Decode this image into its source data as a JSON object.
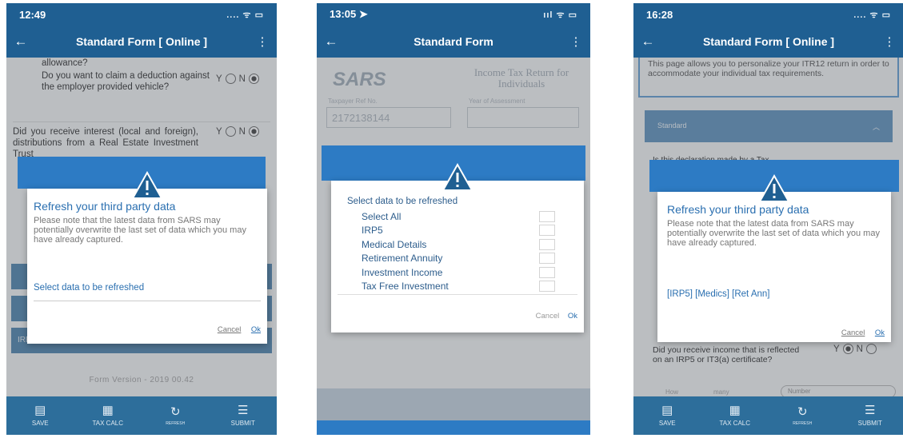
{
  "screens": [
    {
      "time": "12:49",
      "status_right": ".... ᯤ ▭",
      "title": "Standard Form [ Online ]",
      "questions": [
        {
          "text": "allowance?"
        },
        {
          "text": "Do you want to claim a deduction against the employer provided vehicle?",
          "yn": "Y ◯ N ◉"
        },
        {
          "text": "Did you receive interest (local and foreign), distributions from a Real Estate Investment Trust",
          "yn": "Y ◯ N ◉"
        }
      ],
      "bg_item": "IRP5/IT3(a)",
      "form_version": "Form Version - 2019 00.42",
      "dialog": {
        "title": "Refresh your third party data",
        "text": "Please note that the latest data from SARS may potentially overwrite the last set of data which you may have already captured.",
        "select_label": "Select data to be refreshed",
        "cancel": "Cancel",
        "ok": "Ok"
      },
      "nav": [
        {
          "label": "SAVE",
          "icon": "save-icon"
        },
        {
          "label": "TAX CALC",
          "icon": "calculator-icon"
        },
        {
          "label": "REFRESH",
          "icon": "refresh-icon"
        },
        {
          "label": "SUBMIT",
          "icon": "submit-icon"
        }
      ]
    },
    {
      "time": "13:05 ➤",
      "status_right": "ııl ᯤ ▭",
      "title": "Standard Form",
      "bg": {
        "logo": "SARS",
        "heading": "Income Tax Return for Individuals",
        "field1_label": "Taxpayer Ref No.",
        "field1_value": "2172138144",
        "field2_label": "Year of Assessment"
      },
      "dialog": {
        "select_label": "Select data to be refreshed",
        "items": [
          "Select All",
          "IRP5",
          "Medical Details",
          "Retirement Annuity",
          "Investment Income",
          "Tax Free Investment"
        ],
        "cancel": "Cancel",
        "ok": "Ok"
      }
    },
    {
      "time": "16:28",
      "status_right": ".... ᯤ ▭",
      "title": "Standard Form [ Online ]",
      "intro": "This page allows you to personalize your ITR12 return in order to accommodate your individual tax requirements.",
      "section": "Standard",
      "bg_question": "Is this declaration made by a Tax",
      "bottom_question": "Did you receive income that is reflected on an IRP5 or IT3(a) certificate?",
      "bottom_labels": [
        "How",
        "many",
        "Number"
      ],
      "dialog": {
        "title": "Refresh your third party data",
        "text": "Please note that the latest data from SARS may potentially overwrite the last set of data which you may have already captured.",
        "selected": "[IRP5] [Medics] [Ret Ann]",
        "cancel": "Cancel",
        "ok": "Ok"
      },
      "nav": [
        {
          "label": "SAVE",
          "icon": "save-icon"
        },
        {
          "label": "TAX CALC",
          "icon": "calculator-icon"
        },
        {
          "label": "REFRESH",
          "icon": "refresh-icon"
        },
        {
          "label": "SUBMIT",
          "icon": "submit-icon"
        }
      ]
    }
  ],
  "colors": {
    "appbar": "#1f5f92",
    "dialog_header": "#2d7bc4",
    "link": "#2a6fb0",
    "warning_triangle": "#2a6fb0"
  }
}
